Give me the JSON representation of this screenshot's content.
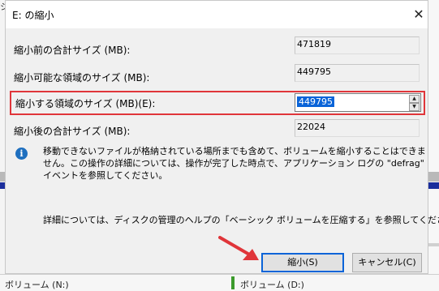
{
  "background": {
    "topleft_char": "シ",
    "volumes": [
      "ボリューム (N:)",
      "ボリューム (D:)"
    ]
  },
  "dialog": {
    "title": "E: の縮小",
    "close_glyph": "✕",
    "fields": [
      {
        "label": "縮小前の合計サイズ (MB):",
        "value": "471819"
      },
      {
        "label": "縮小可能な領域のサイズ (MB):",
        "value": "449795"
      },
      {
        "label": "縮小する領域のサイズ (MB)(E):",
        "value": "449795"
      },
      {
        "label": "縮小後の合計サイズ (MB):",
        "value": "22024"
      }
    ],
    "info_icon": "i",
    "info_text": "移動できないファイルが格納されている場所までも含めて、ボリュームを縮小することはできません。この操作の詳細については、操作が完了した時点で、アプリケーション ログの \"defrag\" イベントを参照してください。",
    "help_text": "詳細については、ディスクの管理のヘルプの「ベーシック ボリュームを圧縮する」を参照してください",
    "buttons": {
      "shrink": "縮小(S)",
      "cancel": "キャンセル(C)"
    },
    "spin_up": "▲",
    "spin_down": "▼"
  },
  "colors": {
    "highlight": "#e0353a",
    "accent": "#0a64d8"
  }
}
